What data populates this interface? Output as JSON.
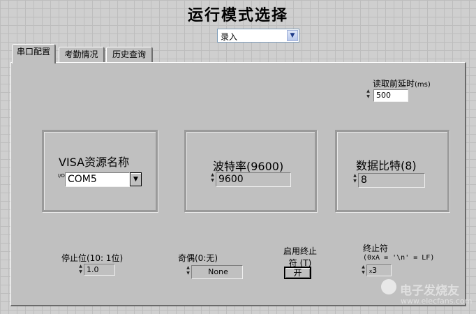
{
  "title": "运行模式选择",
  "mode_select": {
    "value": "录入"
  },
  "tabs": [
    {
      "label": "串口配置"
    },
    {
      "label": "考勤情况"
    },
    {
      "label": "历史查询"
    }
  ],
  "read_delay": {
    "label": "读取前延时",
    "unit": "(ms)",
    "value": "500"
  },
  "visa": {
    "label": "VISA资源名称",
    "prefix": "I/O",
    "value": "COM5"
  },
  "baud": {
    "label": "波特率(9600)",
    "value": "9600"
  },
  "databits": {
    "label": "数据比特(8)",
    "value": "8"
  },
  "stopbits": {
    "label": "停止位(10: 1位)",
    "value": "1.0"
  },
  "parity": {
    "label": "奇偶(0:无)",
    "value": "None"
  },
  "term_enable": {
    "label_line1": "启用终止",
    "label_line2": "符 (T)",
    "button": "开"
  },
  "term_char": {
    "label_line1": "终止符",
    "label_line2": "(0xA = '\\n' = LF)",
    "prefix": "x",
    "value": "3"
  },
  "watermark": {
    "text1": "电子发烧友",
    "text2": "www.elecfans.com"
  }
}
